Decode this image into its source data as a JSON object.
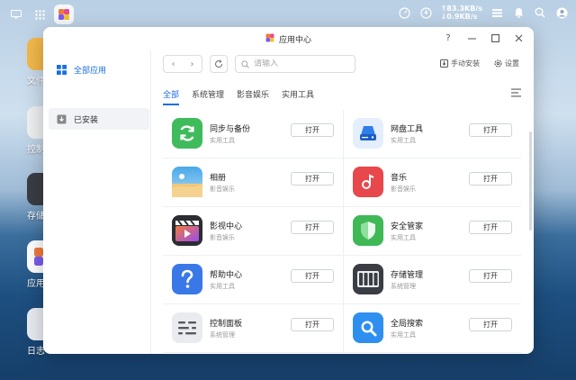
{
  "taskbar": {
    "upload_speed": "83.3KB/s",
    "download_speed": "0.9KB/s"
  },
  "desktop": {
    "icons": [
      {
        "label": "文件"
      },
      {
        "label": "控制"
      },
      {
        "label": "存储"
      },
      {
        "label": "应用"
      },
      {
        "label": "日志"
      }
    ]
  },
  "window": {
    "title": "应用中心",
    "help": "?"
  },
  "sidebar": {
    "items": [
      {
        "label": "全部应用"
      },
      {
        "label": "已安装"
      }
    ]
  },
  "toolbar": {
    "search_placeholder": "请输入",
    "manual_install": "手动安装",
    "settings": "设置"
  },
  "tabs": [
    {
      "label": "全部"
    },
    {
      "label": "系统管理"
    },
    {
      "label": "影音娱乐"
    },
    {
      "label": "实用工具"
    }
  ],
  "apps": [
    {
      "name": "同步与备份",
      "category": "实用工具",
      "button": "打开",
      "color": "#3fbb5c"
    },
    {
      "name": "网盘工具",
      "category": "实用工具",
      "button": "打开",
      "color": "#2f7fe6"
    },
    {
      "name": "相册",
      "category": "影音娱乐",
      "button": "打开",
      "color": "#4aa8e8"
    },
    {
      "name": "音乐",
      "category": "影音娱乐",
      "button": "打开",
      "color": "#e8474c"
    },
    {
      "name": "影视中心",
      "category": "影音娱乐",
      "button": "打开",
      "color": "#e35a6a"
    },
    {
      "name": "安全管家",
      "category": "实用工具",
      "button": "打开",
      "color": "#3fb856"
    },
    {
      "name": "帮助中心",
      "category": "实用工具",
      "button": "打开",
      "color": "#3a78e8"
    },
    {
      "name": "存储管理",
      "category": "系统管理",
      "button": "打开",
      "color": "#3a3d44"
    },
    {
      "name": "控制面板",
      "category": "系统管理",
      "button": "打开",
      "color": "#e9ebee"
    },
    {
      "name": "全局搜索",
      "category": "实用工具",
      "button": "打开",
      "color": "#2e8ff0"
    }
  ]
}
